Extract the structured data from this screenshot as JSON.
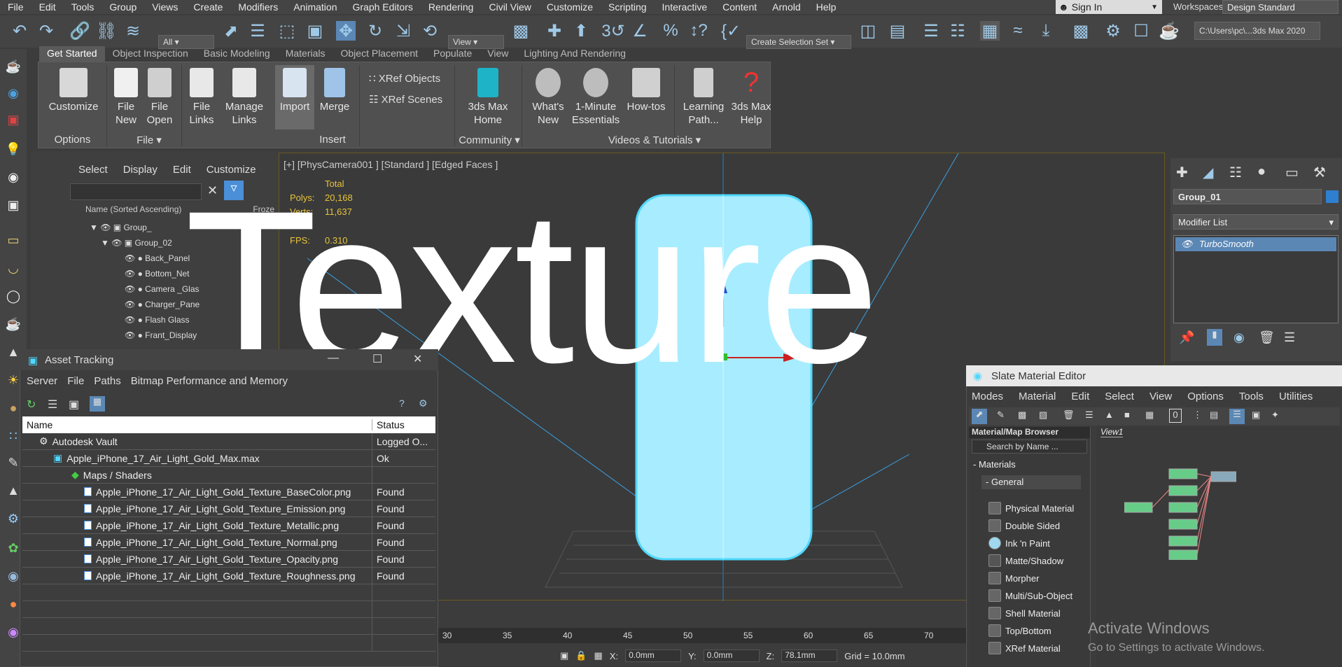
{
  "menu": [
    "File",
    "Edit",
    "Tools",
    "Group",
    "Views",
    "Create",
    "Modifiers",
    "Animation",
    "Graph Editors",
    "Rendering",
    "Civil View",
    "Customize",
    "Scripting",
    "Interactive",
    "Content",
    "Arnold",
    "Help"
  ],
  "sign_in": "Sign In",
  "workspaces_label": "Workspaces:",
  "workspace_value": "Design Standard",
  "toolbar": {
    "filter_value": "All",
    "view_value": "View",
    "create_selection_set": "Create Selection Set",
    "path": "C:\\Users\\pc\\...3ds Max 2020"
  },
  "ribbon_tabs": [
    "Get Started",
    "Object Inspection",
    "Basic Modeling",
    "Materials",
    "Object Placement",
    "Populate",
    "View",
    "Lighting And Rendering"
  ],
  "ribbon": {
    "customize": "Customize",
    "file_new_1": "File",
    "file_new_2": "New",
    "file_open_1": "File",
    "file_open_2": "Open",
    "file_links_1": "File",
    "file_links_2": "Links",
    "manage_links_1": "Manage",
    "manage_links_2": "Links",
    "import": "Import",
    "merge": "Merge",
    "xref_objects": "XRef Objects",
    "xref_scenes": "XRef Scenes",
    "home_1": "3ds Max",
    "home_2": "Home",
    "whats_new_1": "What's",
    "whats_new_2": "New",
    "essentials_1": "1-Minute",
    "essentials_2": "Essentials",
    "howtos": "How-tos",
    "learning_1": "Learning",
    "learning_2": "Path...",
    "help_1": "3ds Max",
    "help_2": "Help",
    "groups": [
      "Options",
      "File",
      "Insert",
      "Community",
      "Videos & Tutorials"
    ]
  },
  "scene_explorer": {
    "menu": [
      "Select",
      "Display",
      "Edit",
      "Customize"
    ],
    "header": "Name (Sorted Ascending)",
    "header_right": "Froze",
    "items": [
      "Group_",
      "Group_02",
      "Back_Panel",
      "Bottom_Net",
      "Camera _Glas",
      "Charger_Pane",
      "Flash Glass",
      "Frant_Display"
    ]
  },
  "viewport": {
    "label": "[+] [PhysCamera001 ] [Standard ] [Edged Faces ]",
    "total": "Total",
    "polys_label": "Polys:",
    "polys": "20,168",
    "verts_label": "Verts:",
    "verts": "11,637",
    "fps_label": "FPS:",
    "fps": "0.310"
  },
  "watermark": "Texture",
  "command_panel": {
    "object_name": "Group_01",
    "modifier_list": "Modifier List",
    "modifier": "TurboSmooth"
  },
  "asset_tracking": {
    "title": "Asset Tracking",
    "menu": [
      "Server",
      "File",
      "Paths",
      "Bitmap Performance and Memory"
    ],
    "columns": [
      "Name",
      "Status"
    ],
    "rows": [
      {
        "name": "Autodesk Vault",
        "status": "Logged O..."
      },
      {
        "name": "Apple_iPhone_17_Air_Light_Gold_Max.max",
        "status": "Ok"
      },
      {
        "name": "Maps / Shaders",
        "status": ""
      },
      {
        "name": "Apple_iPhone_17_Air_Light_Gold_Texture_BaseColor.png",
        "status": "Found"
      },
      {
        "name": "Apple_iPhone_17_Air_Light_Gold_Texture_Emission.png",
        "status": "Found"
      },
      {
        "name": "Apple_iPhone_17_Air_Light_Gold_Texture_Metallic.png",
        "status": "Found"
      },
      {
        "name": "Apple_iPhone_17_Air_Light_Gold_Texture_Normal.png",
        "status": "Found"
      },
      {
        "name": "Apple_iPhone_17_Air_Light_Gold_Texture_Opacity.png",
        "status": "Found"
      },
      {
        "name": "Apple_iPhone_17_Air_Light_Gold_Texture_Roughness.png",
        "status": "Found"
      }
    ]
  },
  "slate": {
    "title": "Slate Material Editor",
    "menu": [
      "Modes",
      "Material",
      "Edit",
      "Select",
      "View",
      "Options",
      "Tools",
      "Utilities"
    ],
    "browser_title": "Material/Map Browser",
    "search_placeholder": "Search by Name ...",
    "view_tab": "View1",
    "materials_label": "Materials",
    "general_label": "General",
    "materials": [
      "Physical Material",
      "Double Sided",
      "Ink 'n Paint",
      "Matte/Shadow",
      "Morpher",
      "Multi/Sub-Object",
      "Shell Material",
      "Top/Bottom",
      "XRef Material"
    ]
  },
  "timeline_ticks": [
    "30",
    "35",
    "40",
    "45",
    "50",
    "55",
    "60",
    "65",
    "70"
  ],
  "status": {
    "x_label": "X:",
    "x": "0.0mm",
    "y_label": "Y:",
    "y": "0.0mm",
    "z_label": "Z:",
    "z": "78.1mm",
    "grid": "Grid = 10.0mm"
  },
  "activate_windows": "Activate Windows",
  "activate_sub": "Go to Settings to activate Windows."
}
